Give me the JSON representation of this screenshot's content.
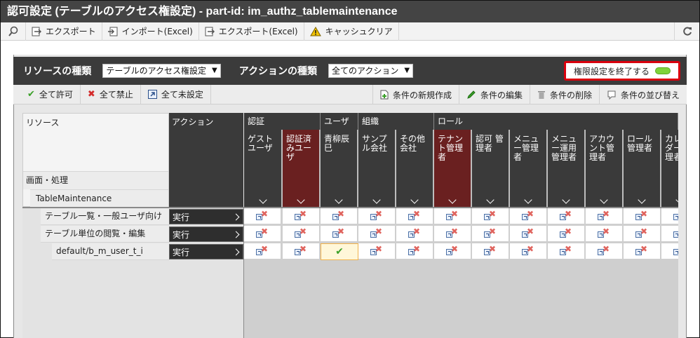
{
  "title": "認可設定 (テーブルのアクセス権設定) - part-id: im_authz_tablemaintenance",
  "toolbar": {
    "export": "エクスポート",
    "import_excel": "インポート(Excel)",
    "export_excel": "エクスポート(Excel)",
    "cache_clear": "キャッシュクリア"
  },
  "resource_bar": {
    "resource_type_label": "リソースの種類",
    "resource_type_value": "テーブルのアクセス権設定",
    "action_type_label": "アクションの種類",
    "action_type_value": "全てのアクション",
    "end_button": "権限設定を終了する"
  },
  "ops": {
    "allow_all": "全て許可",
    "deny_all": "全て禁止",
    "unset_all": "全て未設定",
    "new_condition": "条件の新規作成",
    "edit_condition": "条件の編集",
    "delete_condition": "条件の削除",
    "sort_condition": "条件の並び替え"
  },
  "header": {
    "resource": "リソース",
    "action": "アクション",
    "screen_process": "画面・処理",
    "table_maintenance": "TableMaintenance"
  },
  "groups": [
    "認証",
    "ユーザ",
    "組織",
    "ロール"
  ],
  "columns": [
    {
      "label": "ゲストユーザ"
    },
    {
      "label": "認証済みユーザ"
    },
    {
      "label": "青柳辰巳"
    },
    {
      "label": "サンプル会社"
    },
    {
      "label": "その他会社"
    },
    {
      "label": "テナント管理者"
    },
    {
      "label": "認可 管理者"
    },
    {
      "label": "メニュー管理者"
    },
    {
      "label": "メニュー運用管理者"
    },
    {
      "label": "アカウント管理者"
    },
    {
      "label": "ロール管理者"
    },
    {
      "label": "カレンダー管理者"
    }
  ],
  "rows": [
    {
      "name": "テーブル一覧・一般ユーザ向け",
      "action": "実行"
    },
    {
      "name": "テーブル単位の閲覧・編集",
      "action": "実行"
    },
    {
      "name": "default/b_m_user_t_i",
      "action": "実行"
    }
  ],
  "colors": {
    "titlebar": "#444444",
    "highlight_column": "#6a2020",
    "end_button_border": "#d9000d",
    "status_led": "#7fd33a",
    "allowed_check": "#3aa028"
  }
}
